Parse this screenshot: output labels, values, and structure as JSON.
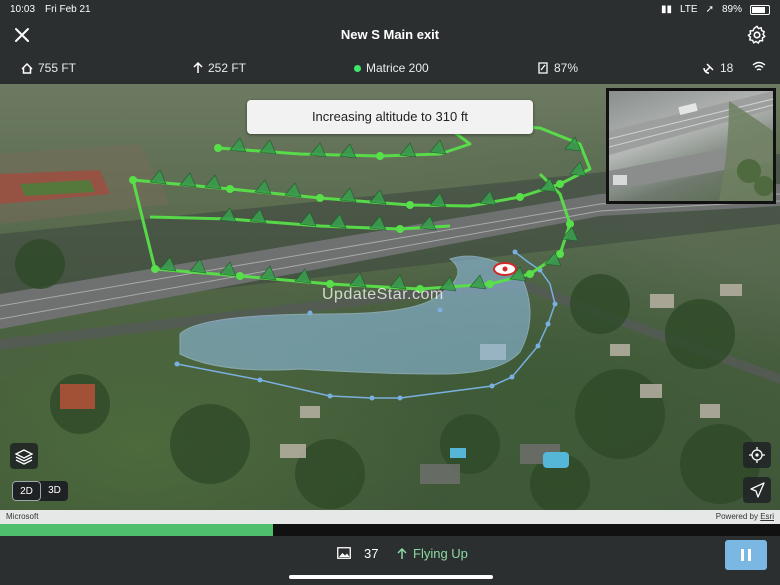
{
  "status_bar": {
    "time": "10:03",
    "date": "Fri Feb 21",
    "network": "LTE",
    "battery": "89%"
  },
  "header": {
    "title": "New S Main exit",
    "close_icon": "close-icon",
    "settings_icon": "gear-icon"
  },
  "telemetry": {
    "home_distance": "755 FT",
    "altitude": "252 FT",
    "aircraft": "Matrice 200",
    "aircraft_status_color": "#3ee86a",
    "aircraft_battery": "87%",
    "satellites": "18"
  },
  "map": {
    "banner": "Increasing altitude to 310 ft",
    "watermark": "UpdateStar.com",
    "view_2d": "2D",
    "view_3d": "3D",
    "active_view": "2D",
    "attribution_left": "Microsoft",
    "attribution_right_prefix": "Powered by ",
    "attribution_right_link": "Esri",
    "route_color": "#58e04a"
  },
  "mission": {
    "progress_fraction": 0.35,
    "photo_count": "37",
    "status": "Flying Up"
  },
  "colors": {
    "accent_green": "#4fbf6b",
    "pause_blue": "#7ab8e3",
    "background": "#2b2f30"
  }
}
